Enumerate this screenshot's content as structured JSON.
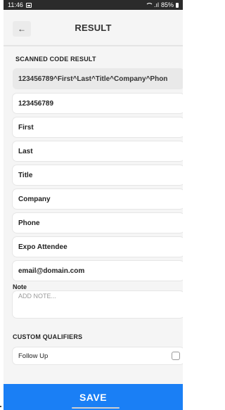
{
  "status_bar": {
    "time": "11:46",
    "battery": "85%"
  },
  "header": {
    "back_icon": "arrow-left-icon",
    "title": "RESULT"
  },
  "scanned": {
    "section_label": "SCANNED CODE RESULT",
    "raw_value": "123456789^First^Last^Title^Company^Phon"
  },
  "fields": [
    {
      "value": "123456789"
    },
    {
      "value": "First"
    },
    {
      "value": "Last"
    },
    {
      "value": "Title"
    },
    {
      "value": "Company"
    },
    {
      "value": "Phone"
    },
    {
      "value": "Expo Attendee"
    },
    {
      "value": "email@domain.com"
    }
  ],
  "note": {
    "label": "Note",
    "placeholder": "ADD NOTE..."
  },
  "custom_qualifiers": {
    "section_label": "CUSTOM QUALIFIERS",
    "items": [
      {
        "label": "Follow Up",
        "checked": false
      }
    ]
  },
  "actions": {
    "save_label": "SAVE"
  },
  "colors": {
    "primary": "#1a7ff5",
    "status_bar": "#2b2b2b"
  }
}
